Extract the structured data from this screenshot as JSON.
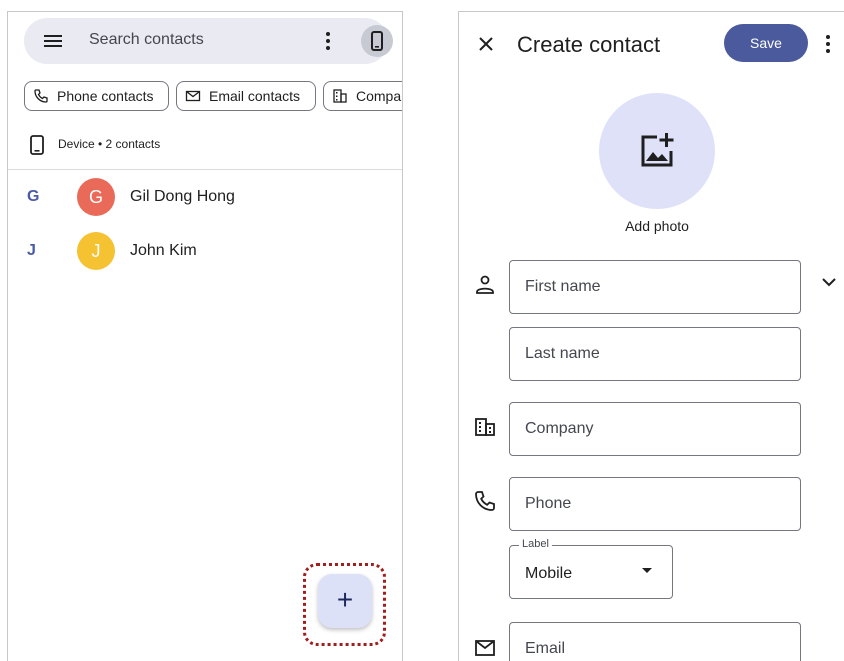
{
  "contacts_list": {
    "search": {
      "placeholder": "Search contacts"
    },
    "filters": [
      {
        "label": "Phone contacts",
        "icon": "phone-icon"
      },
      {
        "label": "Email contacts",
        "icon": "mail-icon"
      },
      {
        "label": "Compar",
        "icon": "building-icon"
      }
    ],
    "source": {
      "label": "Device • 2 contacts"
    },
    "contacts": [
      {
        "letter": "G",
        "initial": "G",
        "name": "Gil Dong Hong",
        "color": "#ea6a5a"
      },
      {
        "letter": "J",
        "initial": "J",
        "name": "John Kim",
        "color": "#f5c232"
      }
    ],
    "fab": {
      "label": "+"
    }
  },
  "create_contact": {
    "title": "Create contact",
    "save_label": "Save",
    "add_photo_label": "Add photo",
    "fields": {
      "first_name": "First name",
      "last_name": "Last name",
      "company": "Company",
      "phone": "Phone",
      "phone_label_legend": "Label",
      "phone_label_value": "Mobile",
      "email": "Email"
    }
  },
  "colors": {
    "accent": "#4a5a9c",
    "search_bg": "#e9eaf2",
    "fab_bg": "#dde1f8",
    "highlight_ring": "#a01e1e"
  }
}
